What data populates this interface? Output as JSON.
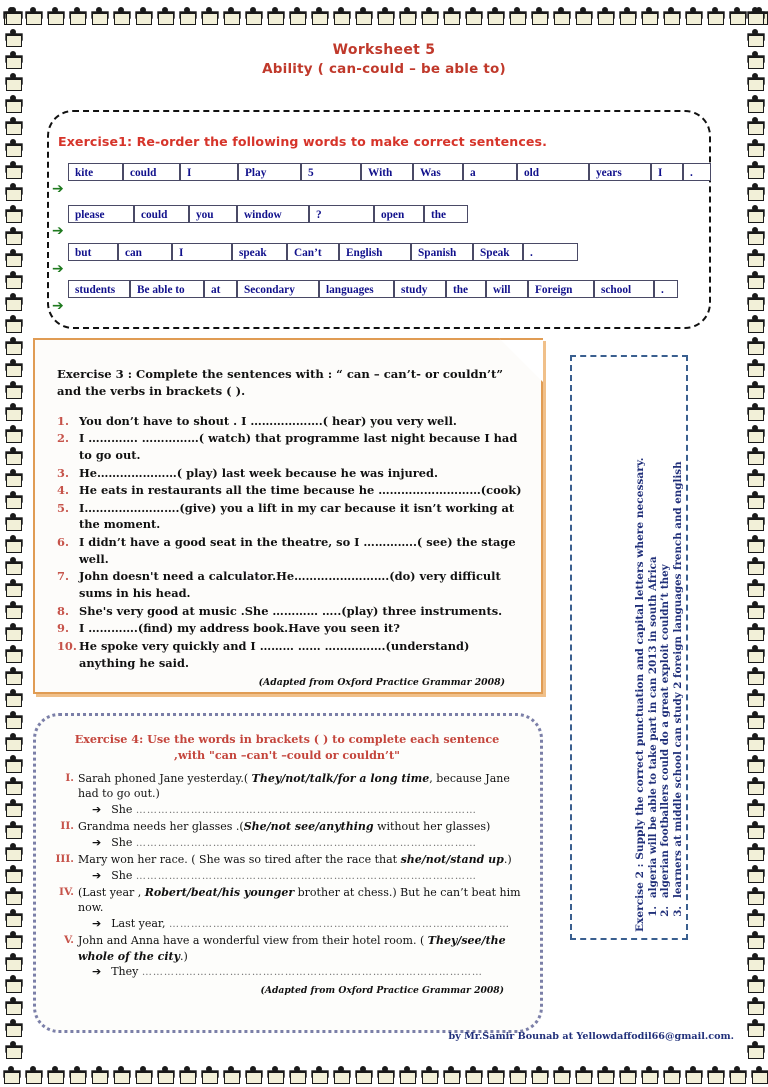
{
  "title": {
    "line1": "Worksheet 5",
    "line2": "Ability ( can-could – be able to)",
    "color": "#c0392b"
  },
  "exercise1": {
    "heading": "Exercise1: Re-order the following words to make correct sentences.",
    "heading_color": "#d6342a",
    "word_color": "#11118c",
    "arrow_icon": "➔",
    "arrow_color": "#1f7a1f",
    "rows": [
      {
        "words": [
          "kite",
          "could",
          "I",
          "Play",
          "5",
          "With",
          "Was",
          "a",
          "old",
          "years",
          "I",
          "."
        ],
        "widths": [
          55,
          57,
          58,
          63,
          60,
          52,
          50,
          54,
          72,
          62,
          32,
          28
        ]
      },
      {
        "words": [
          "please",
          "could",
          "you",
          "window",
          "?",
          "open",
          "the"
        ],
        "widths": [
          66,
          55,
          48,
          72,
          65,
          50,
          44
        ]
      },
      {
        "words": [
          "but",
          "can",
          "I",
          "speak",
          "Can’t",
          "English",
          "Spanish",
          "Speak",
          "."
        ],
        "widths": [
          50,
          54,
          60,
          55,
          52,
          72,
          62,
          50,
          55
        ]
      },
      {
        "words": [
          "students",
          "Be able to",
          "at",
          "Secondary",
          "languages",
          "study",
          "the",
          "will",
          "Foreign",
          "school",
          "."
        ],
        "widths": [
          62,
          74,
          33,
          82,
          75,
          52,
          40,
          42,
          66,
          60,
          24
        ]
      }
    ]
  },
  "exercise2": {
    "title": "Exercise 2 : Supply the correct punctuation and capital letters where necessary.",
    "items": [
      "algeria will be able to take part in can 2013 in south Africa",
      "algerian footballers could do a great exploit couldn’t they",
      "learners at middle school can study 2 foreign languages  french and english"
    ],
    "text_color": "#21307a",
    "border_color": "#3a5f8f"
  },
  "exercise3": {
    "heading": "Exercise 3 :  Complete the sentences with : “ can – can’t- or couldn’t” and the verbs in brackets ( ).",
    "items": [
      "You don’t have to shout . I ……………….( hear) you very well.",
      "I …………. ……………( watch) that programme last night  because I had to go out.",
      "He…………………( play) last week because he was injured.",
      "He eats in restaurants all the time because he ………………………(cook)",
      "I…………………….(give) you a lift in my car because it isn’t working at the moment.",
      "I didn’t have a good seat in the theatre, so I …………..( see) the stage well.",
      "John doesn't need a calculator.He…………………….(do) very difficult sums in his head.",
      "She's very good at music .She ………… …..(play) three instruments.",
      "I ………….(find) my address book.Have you seen it?",
      "    He spoke very quickly and I ……… …… …………….(understand) anything he said."
    ],
    "source": "(Adapted from Oxford Practice Grammar 2008)",
    "border_color": "#e09c54",
    "number_color": "#c6534a"
  },
  "exercise4": {
    "heading_line1": "Exercise 4: Use the words in brackets ( ) to complete each sentence",
    "heading_line2": ",with \"can –can't –could or couldn’t\"",
    "heading_color": "#c4453c",
    "items": [
      {
        "num": "I.",
        "pre": "Sarah phoned Jane yesterday.( ",
        "bold": "They/not/talk/for a long time",
        "post": ", because Jane had to go out.)",
        "answer_lead": "She"
      },
      {
        "num": "II.",
        "pre": "Grandma needs her glasses .(",
        "bold": "She/not see/anything",
        "post": " without her glasses)",
        "answer_lead": "She"
      },
      {
        "num": "III.",
        "pre": "Mary won her race. ( She was so tired after the race that ",
        "bold": "she/not/stand up",
        "post": ".)",
        "answer_lead": "She"
      },
      {
        "num": "IV.",
        "pre": " (Last year , ",
        "bold": "Robert/beat/his younger",
        "post": " brother at chess.) But he can’t beat him now.",
        "answer_lead": "Last year,"
      },
      {
        "num": "V.",
        "pre": "John and Anna have a wonderful view from their hotel room. ( ",
        "bold": "They/see/the whole of the city",
        "post": ".)",
        "answer_lead": "They"
      }
    ],
    "arrow_icon": "➔",
    "source": "(Adapted from Oxford Practice Grammar 2008)",
    "border_color": "#7b7fa8"
  },
  "footer": {
    "text": "by  Mr.Samir Bounab at Yellowdaffodil66@gmail.com.",
    "color": "#21307a"
  },
  "decor": {
    "icon_name": "scarecrow-figure-icon",
    "top_count": 35,
    "side_count": 48
  }
}
